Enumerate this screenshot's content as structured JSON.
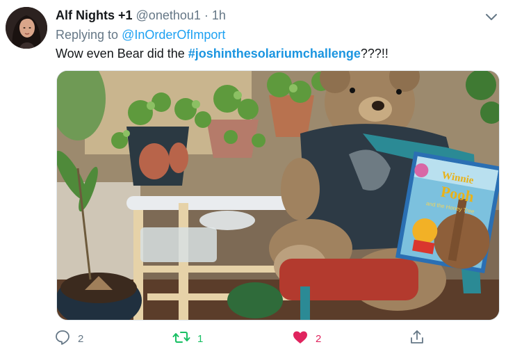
{
  "tweet": {
    "author_name": "Alf Nights +1",
    "handle": "@onethou1",
    "separator": "·",
    "time": "1h",
    "replying_prefix": "Replying to ",
    "replying_to": "@InOrderOfImport",
    "text_prefix": "Wow even Bear did the ",
    "hashtag": "#joshinthesolariumchallenge",
    "text_suffix": "???!!",
    "book_title_line1": "Winnie",
    "book_title_line2": "Pooh",
    "book_subtitle": "and the Honey Tree"
  },
  "actions": {
    "reply_count": "2",
    "retweet_count": "1",
    "like_count": "2"
  },
  "colors": {
    "link": "#1da1f2",
    "retweet": "#17bf63",
    "like": "#e0245e",
    "muted": "#657786"
  },
  "icons": {
    "avatar": "avatar",
    "menu": "chevron-down-icon",
    "reply": "reply-icon",
    "retweet": "retweet-icon",
    "like": "heart-icon",
    "share": "share-icon"
  }
}
